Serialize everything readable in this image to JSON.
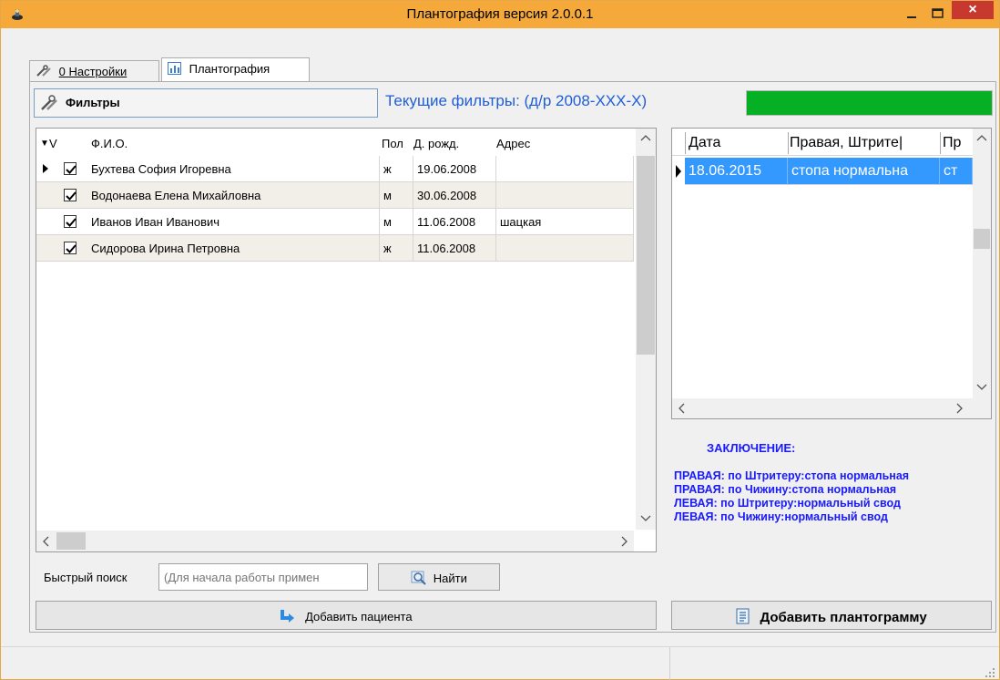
{
  "window": {
    "title": "Плантография версия 2.0.0.1",
    "close_glyph": "×"
  },
  "tabs": [
    {
      "label": "0 Настройки",
      "selected": false
    },
    {
      "label": "Плантография",
      "selected": true
    }
  ],
  "filters": {
    "button_label": "Фильтры",
    "current_text": "Текущие фильтры: (д/р 2008-XXX-X)",
    "progress_fraction": 1.0,
    "progress_color": "#06b025"
  },
  "patients_grid": {
    "columns": [
      "V",
      "Ф.И.О.",
      "Пол",
      "Д. рожд.",
      "Адрес"
    ],
    "sort_glyph": "▼",
    "rows": [
      {
        "checked": true,
        "name": "Бухтева София Игоревна",
        "sex": "ж",
        "dob": "19.06.2008",
        "address": "",
        "current": true
      },
      {
        "checked": true,
        "name": "Водонаева Елена Михайловна",
        "sex": "м",
        "dob": "30.06.2008",
        "address": "",
        "current": false
      },
      {
        "checked": true,
        "name": "Иванов Иван Иванович",
        "sex": "м",
        "dob": "11.06.2008",
        "address": "шацкая",
        "current": false
      },
      {
        "checked": true,
        "name": "Сидорова Ирина Петровна",
        "sex": "ж",
        "dob": "11.06.2008",
        "address": "",
        "current": false
      }
    ]
  },
  "search": {
    "label": "Быстрый поиск",
    "placeholder": "(Для начала работы примен",
    "find_label": "Найти"
  },
  "add_patient_label": "Добавить пациента",
  "plantograms_grid": {
    "columns": [
      "Дата",
      "Правая, Штрите|",
      "Пр"
    ],
    "rows": [
      {
        "date": "18.06.2015",
        "right": "стопа нормальна",
        "pr": "ст",
        "selected": true
      }
    ],
    "selection_color": "#3399ff"
  },
  "conclusion": {
    "title": "ЗАКЛЮЧЕНИЕ:",
    "lines": [
      "ПРАВАЯ: по Штритеру:стопа нормальная",
      "ПРАВАЯ: по Чижину:стопа нормальная",
      "ЛЕВАЯ: по Штритеру:нормальный свод",
      "ЛЕВАЯ: по Чижину:нормальный свод"
    ],
    "color": "#1a1aff"
  },
  "add_plantogram_label": "Добавить плантограмму"
}
